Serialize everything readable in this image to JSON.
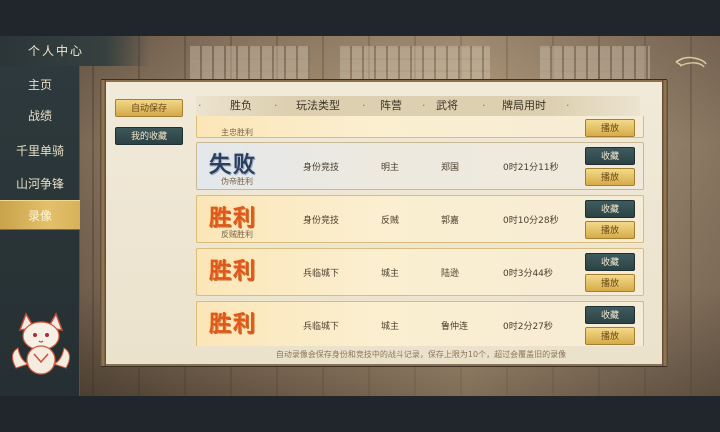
{
  "header": {
    "title": "个人中心"
  },
  "sidebar": {
    "items": [
      {
        "label": "主页",
        "active": false
      },
      {
        "label": "战绩",
        "active": false
      },
      {
        "label": "千里单骑",
        "active": false
      },
      {
        "label": "山河争锋",
        "active": false
      },
      {
        "label": "录像",
        "active": true
      }
    ]
  },
  "filters": {
    "auto_save": "自动保存",
    "favorites": "我的收藏"
  },
  "columns": [
    "胜负",
    "玩法类型",
    "阵营",
    "武将",
    "牌局用时"
  ],
  "partial_record": {
    "sub": "主忠胜利",
    "play_label": "播放"
  },
  "records": [
    {
      "result": "失败",
      "outcome": "loss",
      "sub": "伪帝胜利",
      "mode": "身份竞技",
      "camp": "明主",
      "general": "郑国",
      "duration": "0时21分11秒",
      "fav_label": "收藏",
      "play_label": "播放"
    },
    {
      "result": "胜利",
      "outcome": "win",
      "sub": "反贼胜利",
      "mode": "身份竞技",
      "camp": "反贼",
      "general": "郭嘉",
      "duration": "0时10分28秒",
      "fav_label": "收藏",
      "play_label": "播放"
    },
    {
      "result": "胜利",
      "outcome": "win",
      "sub": "",
      "mode": "兵临城下",
      "camp": "城主",
      "general": "陆逊",
      "duration": "0时3分44秒",
      "fav_label": "收藏",
      "play_label": "播放"
    },
    {
      "result": "胜利",
      "outcome": "win",
      "sub": "",
      "mode": "兵临城下",
      "camp": "城主",
      "general": "鲁仲连",
      "duration": "0时2分27秒",
      "fav_label": "收藏",
      "play_label": "播放"
    }
  ],
  "footer": {
    "note": "自动录像会保存身份和竞技中的战斗记录，保存上限为10个，超过会覆盖旧的录像"
  },
  "icons": {
    "back": "back-arrow-icon",
    "mascot": "fox-mascot-icon"
  },
  "colors": {
    "accent_gold": "#d6ab49",
    "accent_teal": "#2c4345",
    "win_red": "#e0571c",
    "loss_blue": "#2c3f5c"
  }
}
